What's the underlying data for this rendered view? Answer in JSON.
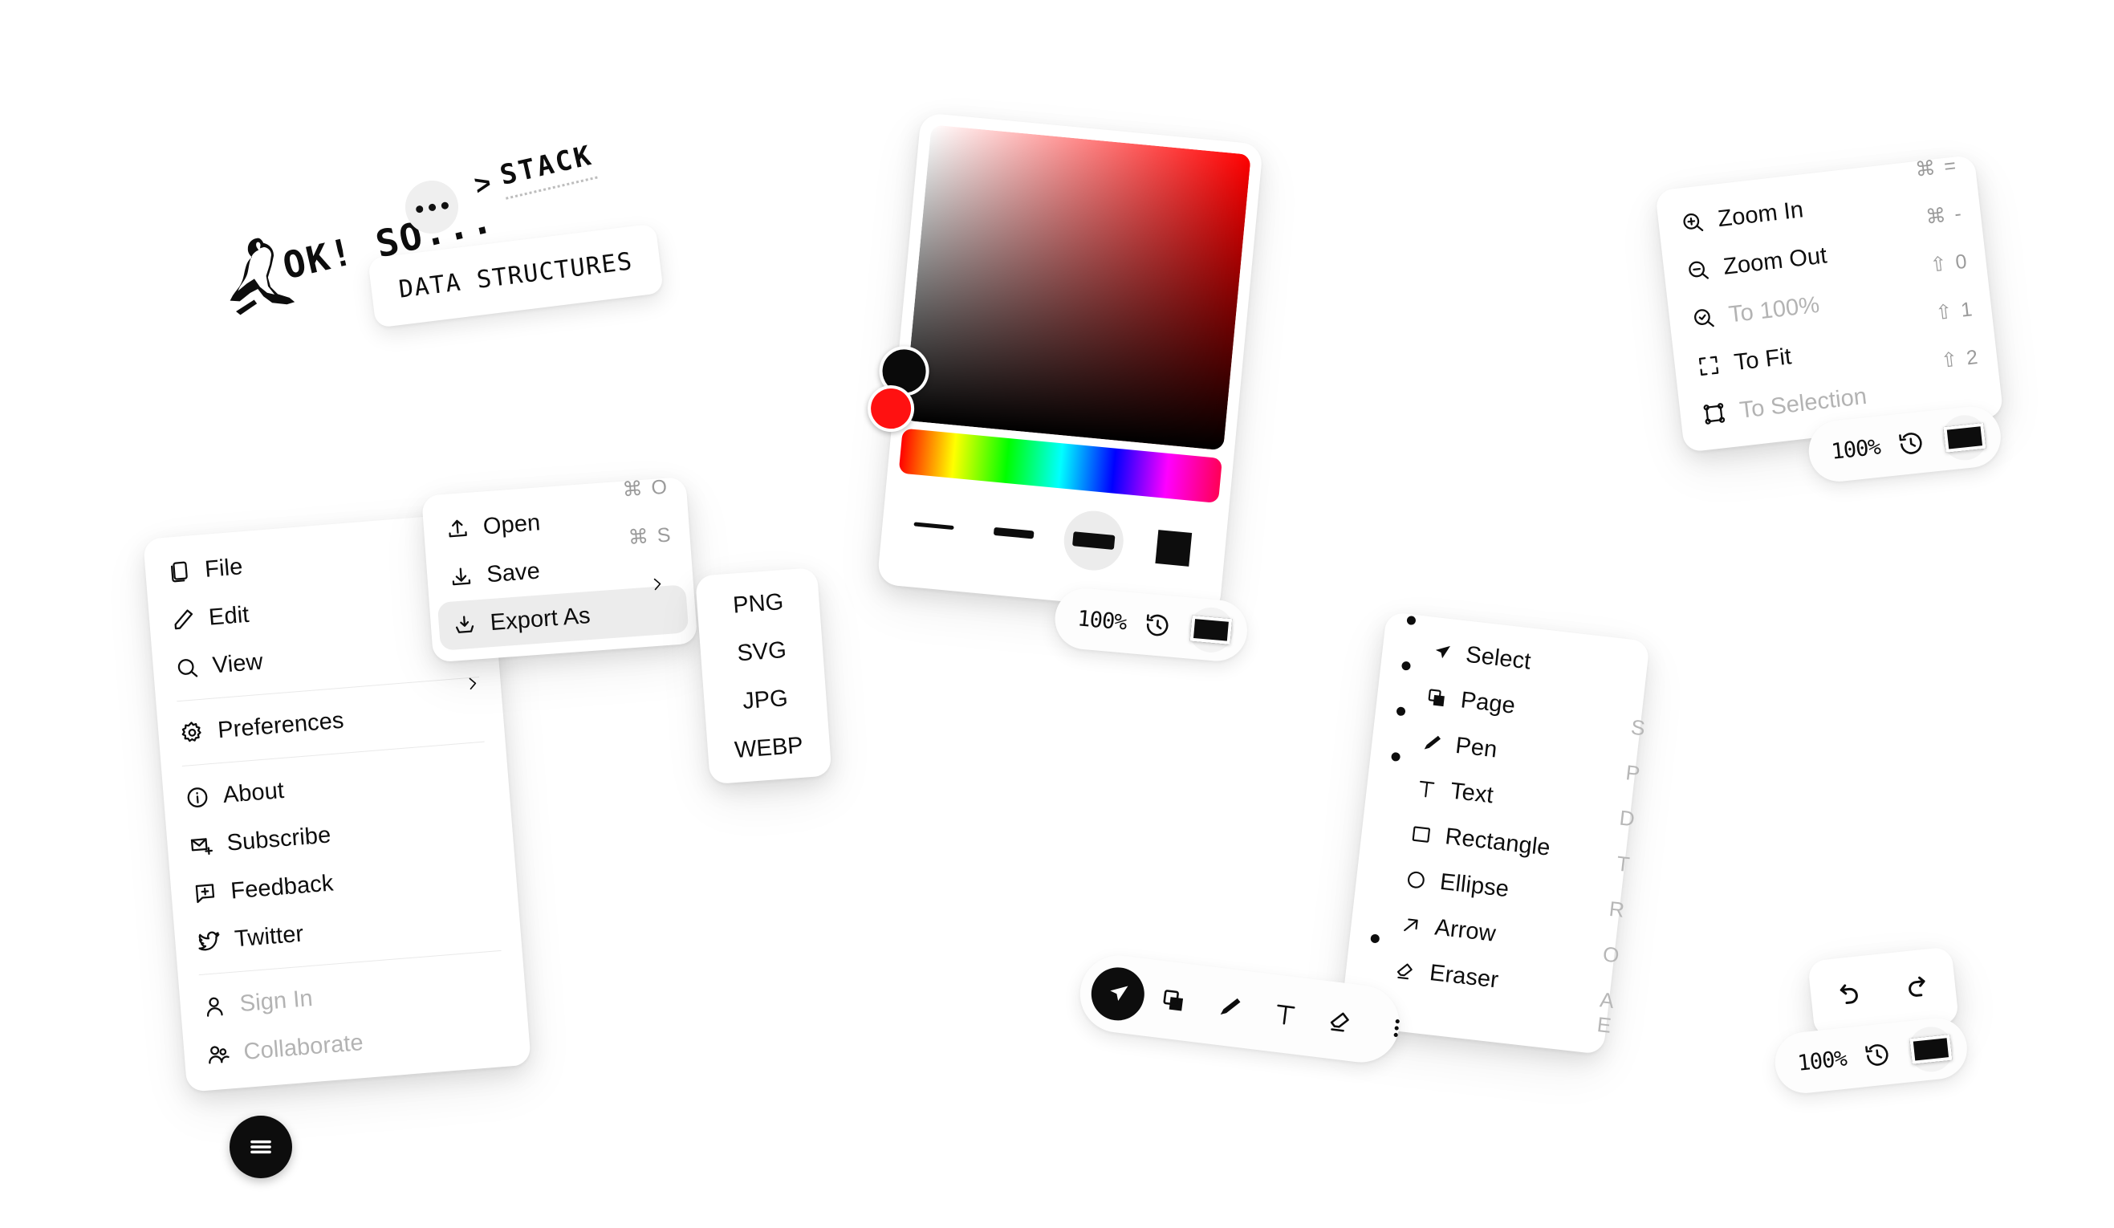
{
  "app": {
    "background": "#ffffff",
    "accent": "#0d0d0d",
    "disabled_color": "#b3b3b3",
    "highlight_color": "#ececec"
  },
  "annotation": {
    "caption": "OK! SO...",
    "more_button_icon": "ellipsis-icon",
    "breadcrumb": {
      "separator": ">",
      "label": "STACK"
    },
    "tooltip": "DATA STRUCTURES",
    "thinker_icon": "thinker-statue-icon"
  },
  "main_menu": {
    "hamburger_icon": "hamburger-icon",
    "groups": [
      {
        "items": [
          {
            "label": "File",
            "icon": "file-icon",
            "submenu": true,
            "shortcut": "",
            "disabled": false
          },
          {
            "label": "Edit",
            "icon": "pencil-icon",
            "submenu": true,
            "shortcut": "",
            "disabled": false
          },
          {
            "label": "View",
            "icon": "search-icon",
            "submenu": true,
            "shortcut": "",
            "disabled": false
          }
        ]
      },
      {
        "items": [
          {
            "label": "Preferences",
            "icon": "gear-icon",
            "submenu": true,
            "shortcut": "",
            "disabled": false
          }
        ]
      },
      {
        "items": [
          {
            "label": "About",
            "icon": "info-icon",
            "submenu": false,
            "shortcut": "",
            "disabled": false
          },
          {
            "label": "Subscribe",
            "icon": "envelope-icon",
            "submenu": false,
            "shortcut": "",
            "disabled": false
          },
          {
            "label": "Feedback",
            "icon": "comment-icon",
            "submenu": false,
            "shortcut": "",
            "disabled": false
          },
          {
            "label": "Twitter",
            "icon": "twitter-icon",
            "submenu": false,
            "shortcut": "",
            "disabled": false
          }
        ]
      },
      {
        "items": [
          {
            "label": "Sign In",
            "icon": "user-icon",
            "submenu": false,
            "shortcut": "",
            "disabled": true
          },
          {
            "label": "Collaborate",
            "icon": "users-icon",
            "submenu": false,
            "shortcut": "",
            "disabled": true
          }
        ]
      }
    ]
  },
  "file_submenu": {
    "items": [
      {
        "label": "Open",
        "icon": "upload-icon",
        "shortcut": "⌘ O",
        "submenu": false,
        "selected": false
      },
      {
        "label": "Save",
        "icon": "download-icon",
        "shortcut": "⌘ S",
        "submenu": false,
        "selected": false
      },
      {
        "label": "Export As",
        "icon": "export-icon",
        "shortcut": "",
        "submenu": true,
        "selected": true
      }
    ]
  },
  "export_menu": {
    "formats": [
      "PNG",
      "SVG",
      "JPG",
      "WEBP"
    ]
  },
  "color_picker": {
    "hue_label": "hue-strip",
    "selected_swatch": "#000000",
    "hue_handle_color": "#ff1111",
    "value_handle_color": "#0a0a0a",
    "gradient_from": "#ffffff",
    "gradient_to": "#ff0000",
    "stroke_options": [
      {
        "name": "thin",
        "selected": false
      },
      {
        "name": "medium",
        "selected": false
      },
      {
        "name": "thick",
        "selected": true
      },
      {
        "name": "fill",
        "selected": false
      }
    ]
  },
  "zoom_menu": {
    "items": [
      {
        "label": "Zoom In",
        "icon": "zoom-in-icon",
        "shortcut": "⌘ =",
        "disabled": false
      },
      {
        "label": "Zoom Out",
        "icon": "zoom-out-icon",
        "shortcut": "⌘ -",
        "disabled": false
      },
      {
        "label": "To 100%",
        "icon": "zoom-reset-icon",
        "shortcut": "⇧ 0",
        "disabled": true
      },
      {
        "label": "To Fit",
        "icon": "fit-icon",
        "shortcut": "⇧ 1",
        "disabled": false
      },
      {
        "label": "To Selection",
        "icon": "selection-fit-icon",
        "shortcut": "⇧ 2",
        "disabled": true
      }
    ]
  },
  "tools_menu": {
    "items": [
      {
        "label": "Select",
        "icon": "cursor-icon",
        "shortcut": "",
        "dot": true
      },
      {
        "label": "Page",
        "icon": "page-icon",
        "shortcut": "S",
        "dot": true
      },
      {
        "label": "Pen",
        "icon": "pen-icon",
        "shortcut": "P",
        "dot": true
      },
      {
        "label": "Text",
        "icon": "text-icon",
        "shortcut": "D",
        "dot": true
      },
      {
        "label": "Rectangle",
        "icon": "rectangle-icon",
        "shortcut": "T",
        "dot": false
      },
      {
        "label": "Ellipse",
        "icon": "ellipse-icon",
        "shortcut": "R",
        "dot": false
      },
      {
        "label": "Arrow",
        "icon": "arrow-icon",
        "shortcut": "O",
        "dot": false
      },
      {
        "label": "Eraser",
        "icon": "eraser-icon",
        "shortcut": "A",
        "dot": true
      },
      {
        "label": "",
        "icon": "",
        "shortcut": "E",
        "dot": false
      }
    ]
  },
  "toolbar": {
    "buttons": [
      {
        "name": "select",
        "icon": "cursor-icon",
        "active": true
      },
      {
        "name": "page",
        "icon": "page-icon",
        "active": false
      },
      {
        "name": "pen",
        "icon": "pen-icon",
        "active": false
      },
      {
        "name": "text",
        "icon": "text-icon",
        "active": false
      },
      {
        "name": "eraser",
        "icon": "eraser-icon",
        "active": false
      },
      {
        "name": "more",
        "icon": "kebab-icon",
        "active": false
      }
    ]
  },
  "status_pills": {
    "color_picker": {
      "zoom": "100%",
      "history_icon": "history-icon",
      "swatch": "#0d0d0d"
    },
    "zoom_menu": {
      "zoom": "100%",
      "history_icon": "history-icon",
      "swatch": "#0d0d0d"
    },
    "undo_redo": {
      "zoom": "100%",
      "history_icon": "history-icon",
      "swatch": "#0d0d0d"
    }
  },
  "undo_redo": {
    "undo_icon": "undo-icon",
    "redo_icon": "redo-icon"
  }
}
